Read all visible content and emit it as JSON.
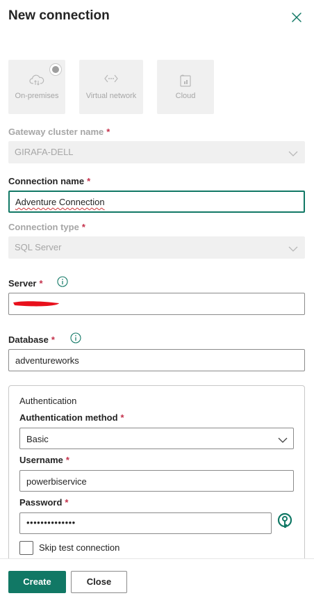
{
  "header": {
    "title": "New connection",
    "close_icon": "close-icon"
  },
  "connection_types": [
    {
      "label": "On-premises",
      "icon": "cloud-upload-icon",
      "selected": true
    },
    {
      "label": "Virtual network",
      "icon": "network-icon",
      "selected": false
    },
    {
      "label": "Cloud",
      "icon": "cloud-report-icon",
      "selected": false
    }
  ],
  "gateway": {
    "label": "Gateway cluster name",
    "required": "*",
    "value": "GIRAFA-DELL"
  },
  "connection_name": {
    "label": "Connection name",
    "required": "*",
    "value": "Adventure Connection"
  },
  "connection_type": {
    "label": "Connection type",
    "required": "*",
    "value": "SQL Server"
  },
  "server": {
    "label": "Server",
    "required": "*",
    "value": "",
    "redacted": true
  },
  "database": {
    "label": "Database",
    "required": "*",
    "value": "adventureworks"
  },
  "authentication": {
    "section_title": "Authentication",
    "method_label": "Authentication method",
    "method_required": "*",
    "method_value": "Basic",
    "username_label": "Username",
    "username_required": "*",
    "username_value": "powerbiservice",
    "password_label": "Password",
    "password_required": "*",
    "password_value": "••••••••••••••",
    "skip_test_label": "Skip test connection",
    "skip_test_checked": false
  },
  "footer": {
    "create_label": "Create",
    "close_label": "Close"
  },
  "colors": {
    "accent": "#117865",
    "required": "#c4314b",
    "redaction": "#e8101c"
  }
}
